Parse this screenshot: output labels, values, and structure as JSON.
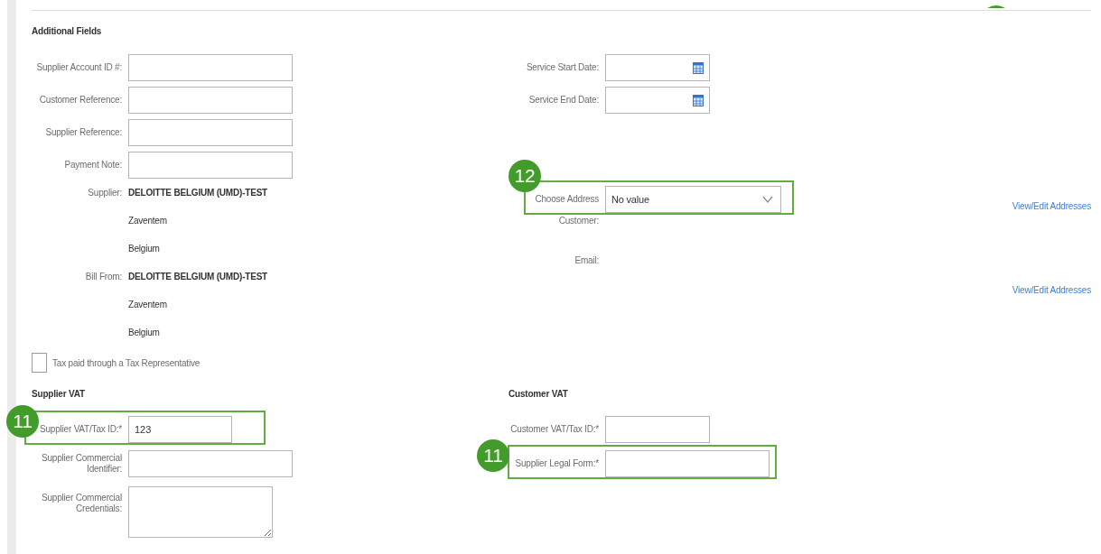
{
  "additional_fields": {
    "title": "Additional Fields",
    "rows": [
      {
        "kind": "input",
        "label": "Supplier Account ID #:"
      },
      {
        "kind": "input",
        "label": "Customer Reference:"
      },
      {
        "kind": "input",
        "label": "Supplier Reference:"
      },
      {
        "kind": "input",
        "label": "Payment Note:"
      },
      {
        "kind": "info",
        "label": "Supplier:",
        "value": "DELOITTE BELGIUM (UMD)-TEST"
      },
      {
        "kind": "line",
        "value": "Zaventem"
      },
      {
        "kind": "line",
        "value": "Belgium"
      },
      {
        "kind": "info",
        "label": "Bill From:",
        "value": "DELOITTE BELGIUM (UMD)-TEST"
      },
      {
        "kind": "line",
        "value": "Zaventem"
      },
      {
        "kind": "line",
        "value": "Belgium"
      }
    ]
  },
  "service_dates": [
    {
      "kind": "date",
      "label": "Service Start Date:"
    },
    {
      "kind": "date",
      "label": "Service End Date:"
    }
  ],
  "customer_address": {
    "rows": [
      {
        "kind": "select",
        "label": "Choose Address",
        "value": "No value",
        "callout": "12"
      },
      {
        "kind": "info",
        "label": "Customer:"
      },
      {
        "kind": "info",
        "label": "Email:"
      }
    ]
  },
  "links": [
    "View/Edit Addresses",
    "View/Edit Addresses"
  ],
  "tax_representative": {
    "label": "Tax paid through a Tax Representative",
    "checked": false
  },
  "supplier_vat": {
    "title": "Supplier VAT",
    "rows": [
      {
        "kind": "input",
        "label": "Supplier VAT/Tax ID:*",
        "value": "123",
        "callout": "11"
      },
      {
        "kind": "input",
        "label": "Supplier Commercial Identifier:"
      },
      {
        "kind": "textarea",
        "label": "Supplier Commercial Credentials:"
      }
    ]
  },
  "customer_vat": {
    "title": "Customer VAT",
    "rows": [
      {
        "kind": "input",
        "label": "Customer VAT/Tax ID:*"
      },
      {
        "kind": "input",
        "label": "Supplier Legal Form:*",
        "callout": "11"
      }
    ]
  }
}
